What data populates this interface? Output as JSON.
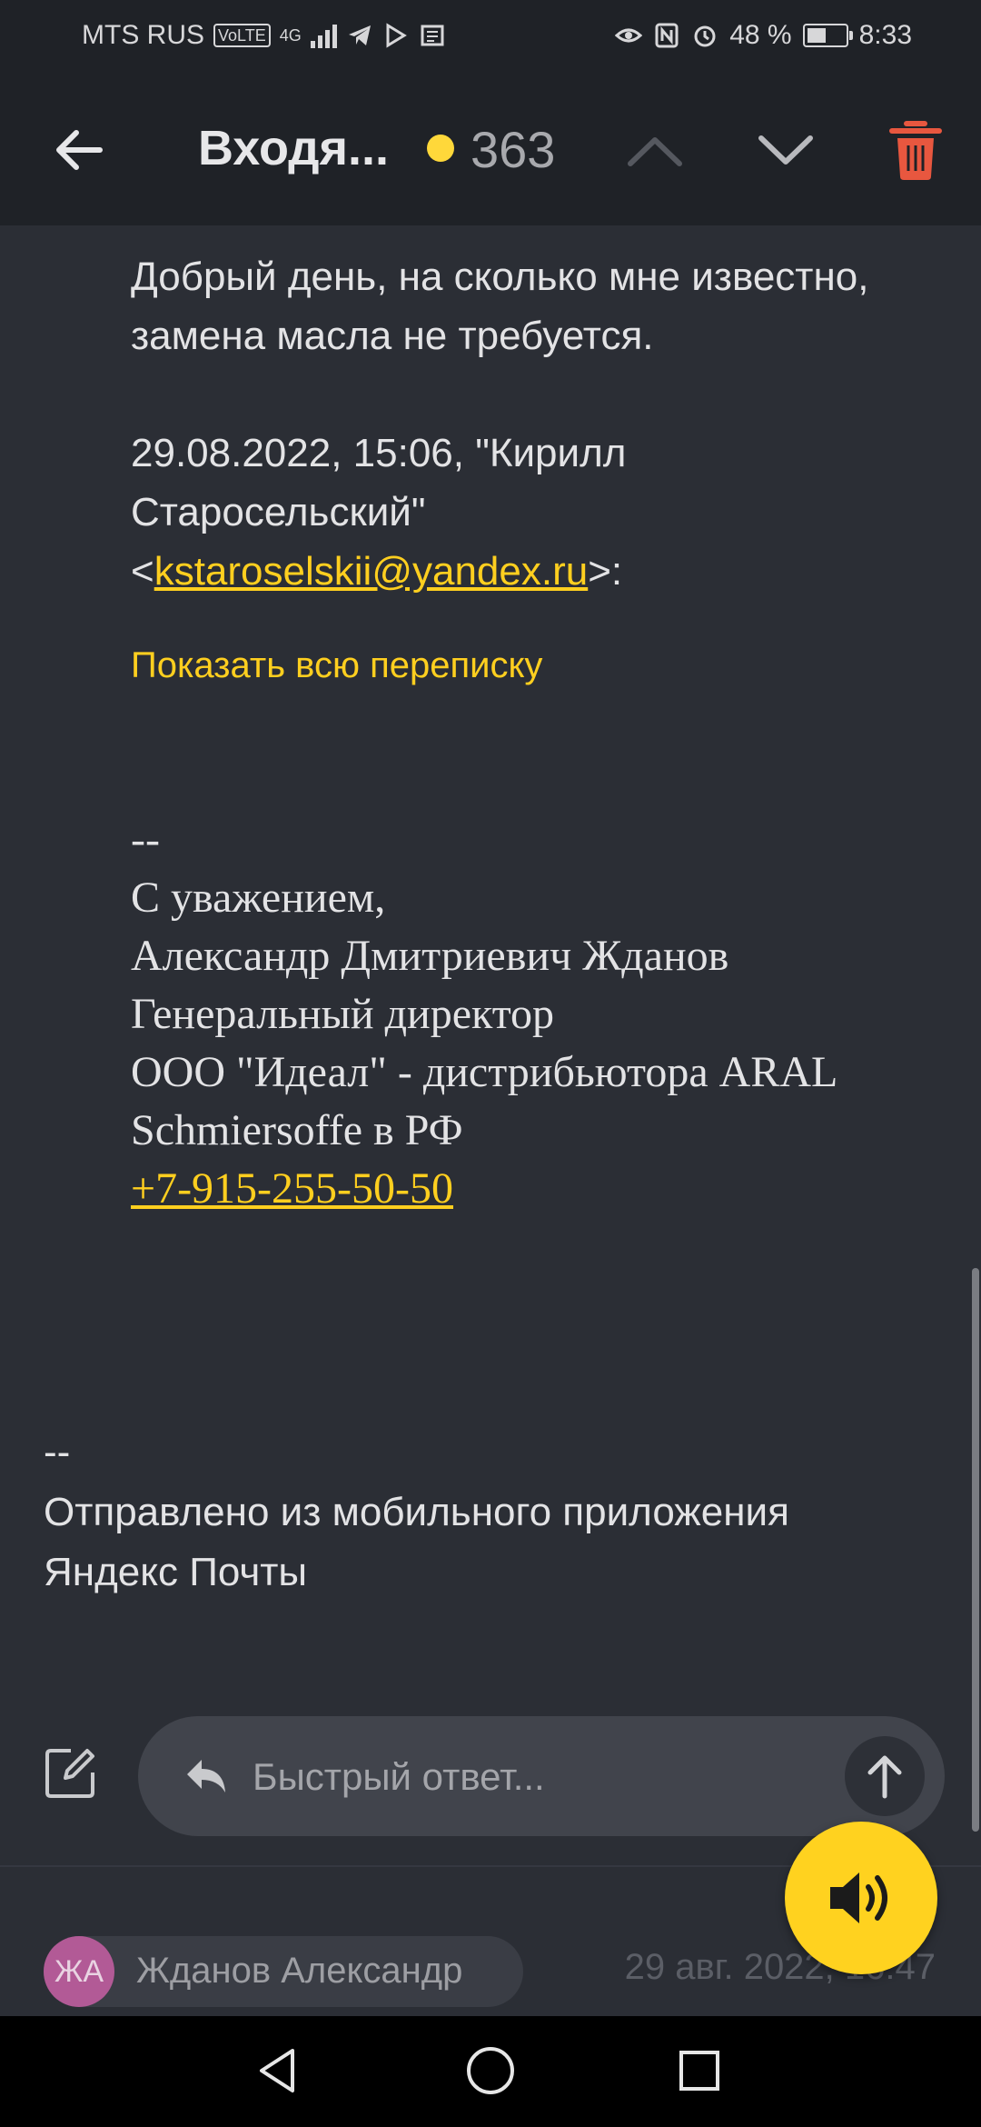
{
  "status_bar": {
    "carrier": "MTS RUS",
    "volte": "VoLTE",
    "network": "4G",
    "battery": "48 %",
    "time": "8:33"
  },
  "header": {
    "folder": "Входя...",
    "unread_count": "363"
  },
  "message": {
    "reply_line1": "Добрый день, на сколько мне известно,",
    "reply_line2": "замена масла не требуется.",
    "quote_line1": "29.08.2022, 15:06, \"Кирилл",
    "quote_line2": "Старосельский\"",
    "quote_email_open": "<",
    "quote_email": "kstaroselskii@yandex.ru",
    "quote_email_close": ">:",
    "show_thread": "Показать всю переписку",
    "sig_dashes": "--",
    "sig_line1": "С уважением,",
    "sig_line2": "Александр Дмитриевич Жданов",
    "sig_line3": "Генеральный директор",
    "sig_line4": "ООО \"Идеал\" - дистрибьютора ARAL",
    "sig_line5": "Schmiersoffe в РФ",
    "sig_phone": "+7-915-255-50-50",
    "footer_dashes": "--",
    "footer_line1": "Отправлено из мобильного приложения",
    "footer_line2": "Яндекс Почты"
  },
  "quick_reply": {
    "placeholder": "Быстрый ответ..."
  },
  "next_message": {
    "avatar_initials": "ЖА",
    "sender": "Жданов Александр",
    "date": "29 авг. 2022, 16:47"
  },
  "colors": {
    "accent": "#ffcf1f",
    "background": "#2b2e35",
    "header": "#1f2227",
    "trash": "#e8573f",
    "avatar": "#b25a96"
  }
}
